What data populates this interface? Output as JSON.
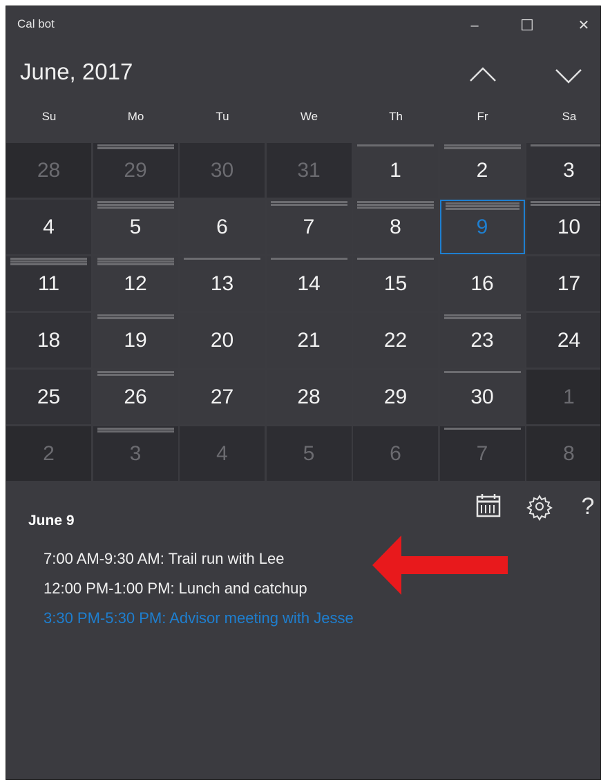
{
  "window": {
    "title": "Cal bot",
    "minimize_glyph": "–",
    "maximize_glyph": "☐",
    "close_glyph": "✕"
  },
  "calendar": {
    "month_label": "June, 2017",
    "weekdays": [
      "Su",
      "Mo",
      "Tu",
      "We",
      "Th",
      "Fr",
      "Sa"
    ],
    "selected_day": "9",
    "weeks": [
      [
        {
          "d": "28",
          "other": true
        },
        {
          "d": "29",
          "other": true,
          "events": 2
        },
        {
          "d": "30",
          "other": true
        },
        {
          "d": "31",
          "other": true
        },
        {
          "d": "1",
          "events": 1
        },
        {
          "d": "2",
          "events": 2
        },
        {
          "d": "3",
          "events": 1
        }
      ],
      [
        {
          "d": "4"
        },
        {
          "d": "5",
          "events": 3
        },
        {
          "d": "6"
        },
        {
          "d": "7",
          "events": 2
        },
        {
          "d": "8",
          "events": 3
        },
        {
          "d": "9",
          "events": 3,
          "selected": true
        },
        {
          "d": "10",
          "events": 2
        }
      ],
      [
        {
          "d": "11",
          "events": 3
        },
        {
          "d": "12",
          "events": 3
        },
        {
          "d": "13",
          "events": 1
        },
        {
          "d": "14",
          "events": 1
        },
        {
          "d": "15",
          "events": 1
        },
        {
          "d": "16"
        },
        {
          "d": "17"
        }
      ],
      [
        {
          "d": "18"
        },
        {
          "d": "19",
          "events": 2
        },
        {
          "d": "20"
        },
        {
          "d": "21"
        },
        {
          "d": "22"
        },
        {
          "d": "23",
          "events": 2
        },
        {
          "d": "24"
        }
      ],
      [
        {
          "d": "25"
        },
        {
          "d": "26",
          "events": 2
        },
        {
          "d": "27"
        },
        {
          "d": "28"
        },
        {
          "d": "29"
        },
        {
          "d": "30",
          "events": 1
        },
        {
          "d": "1",
          "other": true
        }
      ],
      [
        {
          "d": "2",
          "other": true
        },
        {
          "d": "3",
          "other": true,
          "events": 2
        },
        {
          "d": "4",
          "other": true
        },
        {
          "d": "5",
          "other": true
        },
        {
          "d": "6",
          "other": true
        },
        {
          "d": "7",
          "other": true,
          "events": 1
        },
        {
          "d": "8",
          "other": true
        }
      ]
    ]
  },
  "toolbar": {
    "help_label": "?"
  },
  "icons": [
    "calendar-icon",
    "settings-gear-icon",
    "help-icon",
    "chevron-up-icon",
    "chevron-down-icon",
    "red-arrow-annotation"
  ],
  "colors": {
    "accent": "#1e7fd0",
    "background": "#3b3b40",
    "arrow": "#e8191c"
  },
  "detail": {
    "date": "June 9",
    "events": [
      {
        "text": "7:00 AM-9:30 AM: Trail run with Lee",
        "highlight": false
      },
      {
        "text": "12:00 PM-1:00 PM: Lunch and catchup",
        "highlight": false
      },
      {
        "text": "3:30 PM-5:30 PM: Advisor meeting with Jesse",
        "highlight": true
      }
    ]
  }
}
